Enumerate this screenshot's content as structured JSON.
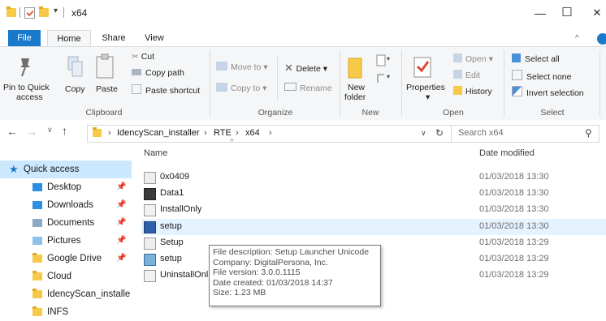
{
  "window": {
    "title": "x64",
    "min": "—",
    "max": "☐",
    "close": "✕"
  },
  "tabs": [
    "File",
    "Home",
    "Share",
    "View"
  ],
  "ribbon": {
    "clipboard": {
      "pin": "Pin to Quick",
      "pin2": "access",
      "copy": "Copy",
      "paste": "Paste",
      "cut": "Cut",
      "copy_path": "Copy path",
      "paste_shortcut": "Paste shortcut",
      "group": "Clipboard"
    },
    "organize": {
      "move_to": "Move to",
      "copy_to": "Copy to",
      "delete": "Delete",
      "rename": "Rename",
      "group": "Organize"
    },
    "new": {
      "new_folder": "New",
      "new_folder2": "folder",
      "group": "New"
    },
    "open": {
      "properties": "Properties",
      "open": "Open",
      "edit": "Edit",
      "history": "History",
      "group": "Open"
    },
    "select": {
      "select_all": "Select all",
      "select_none": "Select none",
      "invert": "Invert selection",
      "group": "Select"
    }
  },
  "address": {
    "path": [
      "IdencyScan_installer",
      "RTE",
      "x64"
    ],
    "search_placeholder": "Search x64"
  },
  "nav": {
    "quick_access": "Quick access",
    "items": [
      {
        "label": "Desktop",
        "pinned": true
      },
      {
        "label": "Downloads",
        "pinned": true
      },
      {
        "label": "Documents",
        "pinned": true
      },
      {
        "label": "Pictures",
        "pinned": true
      },
      {
        "label": "Google Drive",
        "pinned": true
      },
      {
        "label": "Cloud",
        "pinned": false
      },
      {
        "label": "IdencyScan_installe",
        "pinned": false
      },
      {
        "label": "INFS",
        "pinned": false
      }
    ]
  },
  "columns": {
    "name": "Name",
    "date": "Date modified"
  },
  "files": [
    {
      "name": "0x0409",
      "date": "01/03/2018 13:30",
      "icon": "settings-file-icon"
    },
    {
      "name": "Data1",
      "date": "01/03/2018 13:30",
      "icon": "cab-file-icon"
    },
    {
      "name": "InstallOnly",
      "date": "01/03/2018 13:30",
      "icon": "config-file-icon"
    },
    {
      "name": "setup",
      "date": "01/03/2018 13:30",
      "icon": "installer-exe-icon",
      "selected": true
    },
    {
      "name": "Setup",
      "date": "01/03/2018 13:29",
      "icon": "settings-file-icon"
    },
    {
      "name": "setup",
      "date": "01/03/2018 13:29",
      "icon": "package-icon"
    },
    {
      "name": "UninstallOnl",
      "date": "01/03/2018 13:29",
      "icon": "config-file-icon"
    }
  ],
  "tooltip": [
    "File description: Setup Launcher Unicode",
    "Company: DigitalPersona, Inc.",
    "File version: 3.0.0.1115",
    "Date created: 01/03/2018 14:37",
    "Size: 1.23 MB"
  ],
  "colors": {
    "accent": "#1979ca",
    "selected_row": "#cce8ff",
    "folder": "#f7c948"
  }
}
